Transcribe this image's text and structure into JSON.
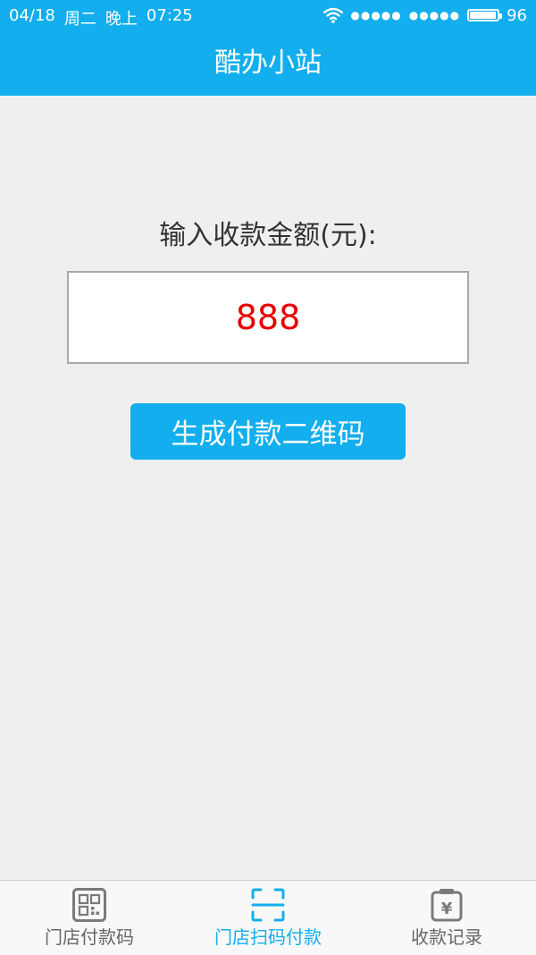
{
  "status_bar": {
    "date": "04/18",
    "weekday": "周二",
    "period": "晚上",
    "time": "07:25",
    "signal_1": "●●●●●",
    "signal_2": "●●●●●",
    "battery_level": 96,
    "battery_text": "96"
  },
  "header": {
    "title": "酷办小站"
  },
  "form": {
    "amount_label": "输入收款金额(元):",
    "amount_value": "888",
    "generate_button_label": "生成付款二维码"
  },
  "bottom_nav": {
    "items": [
      {
        "label": "门店付款码",
        "icon": "qr-code-icon",
        "active": false
      },
      {
        "label": "门店扫码付款",
        "icon": "scan-icon",
        "active": true
      },
      {
        "label": "收款记录",
        "icon": "yuan-record-icon",
        "active": false
      }
    ]
  },
  "colors": {
    "accent": "#12aeed",
    "amount_text": "#e80000",
    "background": "#efefef"
  }
}
